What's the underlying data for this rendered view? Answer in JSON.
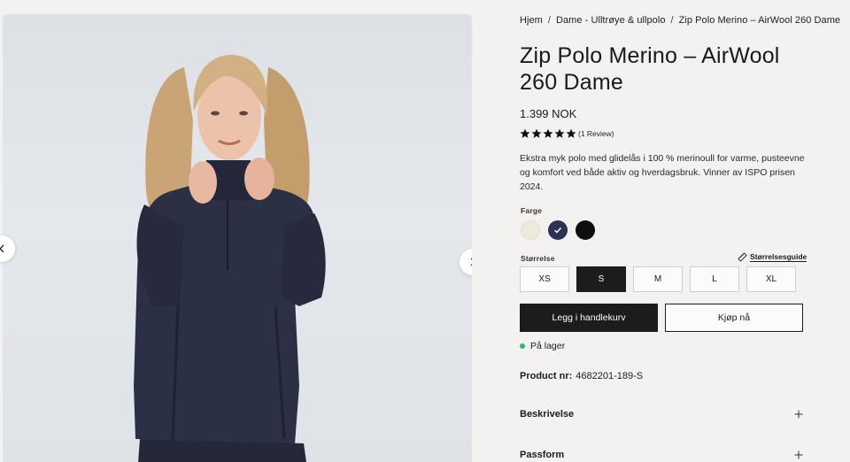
{
  "gallery": {
    "prev_icon": "chevron-left-icon",
    "next_icon": "chevron-right-icon"
  },
  "breadcrumb": [
    "Hjem",
    "Dame - Ulltrøye & ullpolo",
    "Zip Polo Merino – AirWool 260 Dame"
  ],
  "breadcrumb_separator": "/",
  "product": {
    "title": "Zip Polo Merino – AirWool 260 Dame",
    "price": "1.399 NOK",
    "rating": 5,
    "review_text": "(1 Review)",
    "description": "Ekstra myk polo med glidelås i 100 % merinoull for varme, pusteevne og komfort ved både aktiv og hverdagsbruk. Vinner av ISPO prisen 2024.",
    "color_label": "Farge",
    "colors": [
      {
        "name": "offwhite",
        "hex": "#efe9dc",
        "selected": false
      },
      {
        "name": "navy",
        "hex": "#2a3352",
        "selected": true
      },
      {
        "name": "black",
        "hex": "#0d0d0d",
        "selected": false
      }
    ],
    "size_label": "Størrelse",
    "size_guide": "Størrelsesguide",
    "sizes": [
      "XS",
      "S",
      "M",
      "L",
      "XL"
    ],
    "selected_size": "S",
    "add_to_cart": "Legg i handlekurv",
    "buy_now": "Kjøp nå",
    "stock_status": "På lager",
    "stock_color": "#3bb273",
    "product_nr_label": "Product nr:",
    "product_nr": "4682201-189-S",
    "accordions": [
      "Beskrivelse",
      "Passform"
    ]
  }
}
